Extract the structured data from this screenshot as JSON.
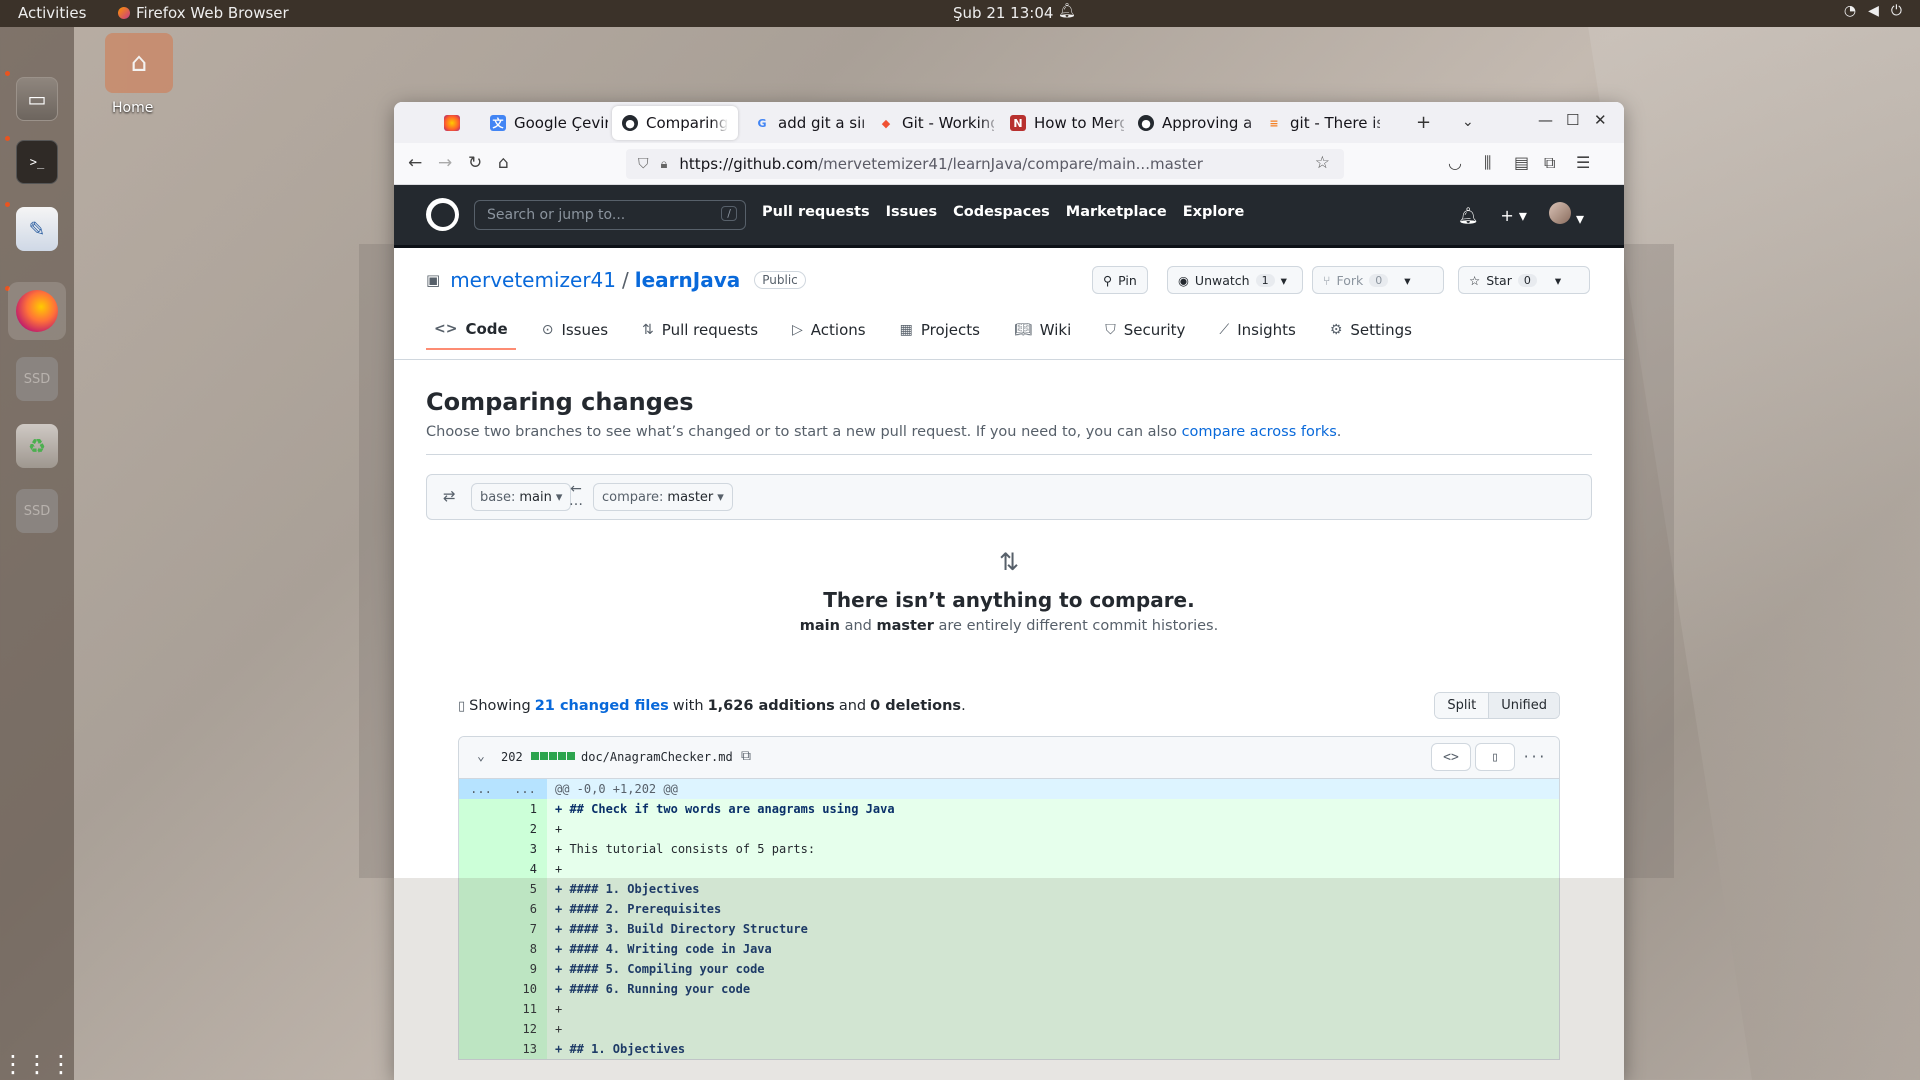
{
  "topbar": {
    "activities": "Activities",
    "app_name": "Firefox Web Browser",
    "clock": "Şub 21  13:04"
  },
  "desktop": {
    "home_label": "Home",
    "dock": [
      "files-icon",
      "terminal-icon",
      "text-editor-icon",
      "firefox-icon",
      "ssd-drive-icon",
      "trash-icon",
      "ssd-drive-icon",
      "app-grid-icon"
    ],
    "ssd_label": "SSD"
  },
  "browser": {
    "tabs": [
      {
        "label": "",
        "icon": "firefox-icon"
      },
      {
        "label": "Google Çeviri",
        "icon": "translate-icon"
      },
      {
        "label": "Comparing",
        "icon": "github-icon",
        "active": true
      },
      {
        "label": "add git a sing",
        "icon": "google-icon"
      },
      {
        "label": "Git - Working",
        "icon": "git-icon"
      },
      {
        "label": "How to Merg",
        "icon": "site-icon"
      },
      {
        "label": "Approving a p",
        "icon": "github-icon"
      },
      {
        "label": "git - There isn",
        "icon": "stackoverflow-icon"
      }
    ],
    "url_prefix": "https://github.com",
    "url_path": "/mervetemizer41/learnJava/compare/main...master"
  },
  "github": {
    "search_placeholder": "Search or jump to...",
    "search_key": "/",
    "nav": [
      "Pull requests",
      "Issues",
      "Codespaces",
      "Marketplace",
      "Explore"
    ]
  },
  "repo": {
    "owner": "mervetemizer41",
    "separator": "/",
    "name": "learnJava",
    "visibility": "Public",
    "pin_label": "Pin",
    "unwatch_label": "Unwatch",
    "unwatch_count": "1",
    "fork_label": "Fork",
    "fork_count": "0",
    "star_label": "Star",
    "star_count": "0",
    "tabs": [
      "Code",
      "Issues",
      "Pull requests",
      "Actions",
      "Projects",
      "Wiki",
      "Security",
      "Insights",
      "Settings"
    ]
  },
  "compare": {
    "title": "Comparing changes",
    "subtitle": "Choose two branches to see what’s changed or to start a new pull request. If you need to, you can also ",
    "subtitle_link": "compare across forks",
    "subtitle_end": ".",
    "base_prefix": "base:",
    "base_branch": "main",
    "compare_prefix": "compare:",
    "compare_branch": "master",
    "blank_title": "There isn’t anything to compare.",
    "blank_branch1": "main",
    "blank_and": " and ",
    "blank_branch2": "master",
    "blank_rest": " are entirely different commit histories.",
    "showing": "Showing",
    "changed_files": "21 changed files",
    "with": "with",
    "additions": "1,626 additions",
    "and": "and",
    "deletions": "0 deletions",
    "period": ".",
    "split_label": "Split",
    "unified_label": "Unified"
  },
  "file": {
    "changes": "202",
    "path": "doc/AnagramChecker.md",
    "hunk_left": "...",
    "hunk_right": "...",
    "hunk": "@@ -0,0 +1,202 @@",
    "lines": [
      {
        "n": "1",
        "text": "+ ## Check if two words are anagrams using Java",
        "hdr": true
      },
      {
        "n": "2",
        "text": "+",
        "hdr": false
      },
      {
        "n": "3",
        "text": "+ This tutorial consists of 5 parts:",
        "hdr": false
      },
      {
        "n": "4",
        "text": "+",
        "hdr": false
      },
      {
        "n": "5",
        "text": "+ #### 1. Objectives",
        "hdr": true
      },
      {
        "n": "6",
        "text": "+ #### 2. Prerequisites",
        "hdr": true
      },
      {
        "n": "7",
        "text": "+ #### 3. Build Directory Structure",
        "hdr": true
      },
      {
        "n": "8",
        "text": "+ #### 4. Writing code in Java",
        "hdr": true
      },
      {
        "n": "9",
        "text": "+ #### 5. Compiling your code",
        "hdr": true
      },
      {
        "n": "10",
        "text": "+ #### 6. Running your code",
        "hdr": true
      },
      {
        "n": "11",
        "text": "+",
        "hdr": false
      },
      {
        "n": "12",
        "text": "+",
        "hdr": false
      },
      {
        "n": "13",
        "text": "+ ## 1. Objectives",
        "hdr": true
      }
    ]
  }
}
